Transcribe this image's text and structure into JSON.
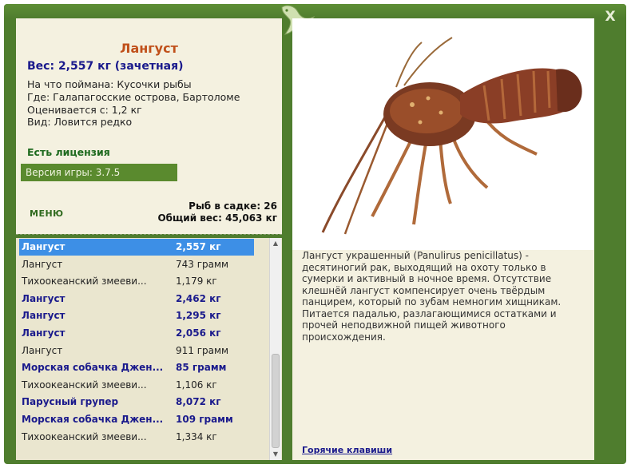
{
  "window": {
    "close_label": "X"
  },
  "info": {
    "name": "Лангуст",
    "weight": "Вес: 2,557 кг (зачетная)",
    "bait": "На что поймана: Кусочки рыбы",
    "location": "Где: Галапагосские острова, Бартоломе",
    "valued_from": "Оценивается с: 1,2 кг",
    "kind": "Вид: Ловится редко",
    "license": "Есть лицензия",
    "version": "Версия игры: 3.7.5",
    "menu_label": "МЕНЮ",
    "fish_in_net": "Рыб в садке: 26",
    "total_weight": "Общий вес: 45,063 кг"
  },
  "catch_list": {
    "rows": [
      {
        "name": "Лангуст",
        "weight": "2,557 кг",
        "bold": true,
        "selected": true
      },
      {
        "name": "Лангуст",
        "weight": "743 грамм",
        "bold": false,
        "selected": false
      },
      {
        "name": "Тихоокеанский змееви...",
        "weight": "1,179 кг",
        "bold": false,
        "selected": false
      },
      {
        "name": "Лангуст",
        "weight": "2,462 кг",
        "bold": true,
        "selected": false
      },
      {
        "name": "Лангуст",
        "weight": "1,295 кг",
        "bold": true,
        "selected": false
      },
      {
        "name": "Лангуст",
        "weight": "2,056 кг",
        "bold": true,
        "selected": false
      },
      {
        "name": "Лангуст",
        "weight": "911 грамм",
        "bold": false,
        "selected": false
      },
      {
        "name": "Морская собачка Джен...",
        "weight": "85 грамм",
        "bold": true,
        "selected": false
      },
      {
        "name": "Тихоокеанский змееви...",
        "weight": "1,106 кг",
        "bold": false,
        "selected": false
      },
      {
        "name": "Парусный групер",
        "weight": "8,072 кг",
        "bold": true,
        "selected": false
      },
      {
        "name": "Морская собачка Джен...",
        "weight": "109 грамм",
        "bold": true,
        "selected": false
      },
      {
        "name": "Тихоокеанский змееви...",
        "weight": "1,334 кг",
        "bold": false,
        "selected": false
      }
    ]
  },
  "description": "Лангуст украшенный (Panulirus penicillatus) - десятиногий рак, выходящий на охоту только в сумерки и активный в ночное время. Отсутствие клешнёй лангуст компенсирует очень твёрдым панцирем, который по зубам немногим хищникам. Питается падалью, разлагающимися остатками и прочей неподвижной пищей животного происхождения.",
  "hotkeys_label": "Горячие клавиши",
  "colors": {
    "frame_green": "#4f7d2e",
    "panel_bg": "#f4f1e0",
    "list_bg": "#eae6cf",
    "selected_row": "#3d8fe6",
    "bold_text": "#1a1a8c",
    "title_orange": "#c0501a"
  },
  "icons": {
    "close": "close-icon",
    "emblem": "lizard-emblem-icon",
    "scroll_up": "chevron-up-icon",
    "scroll_down": "chevron-down-icon"
  }
}
